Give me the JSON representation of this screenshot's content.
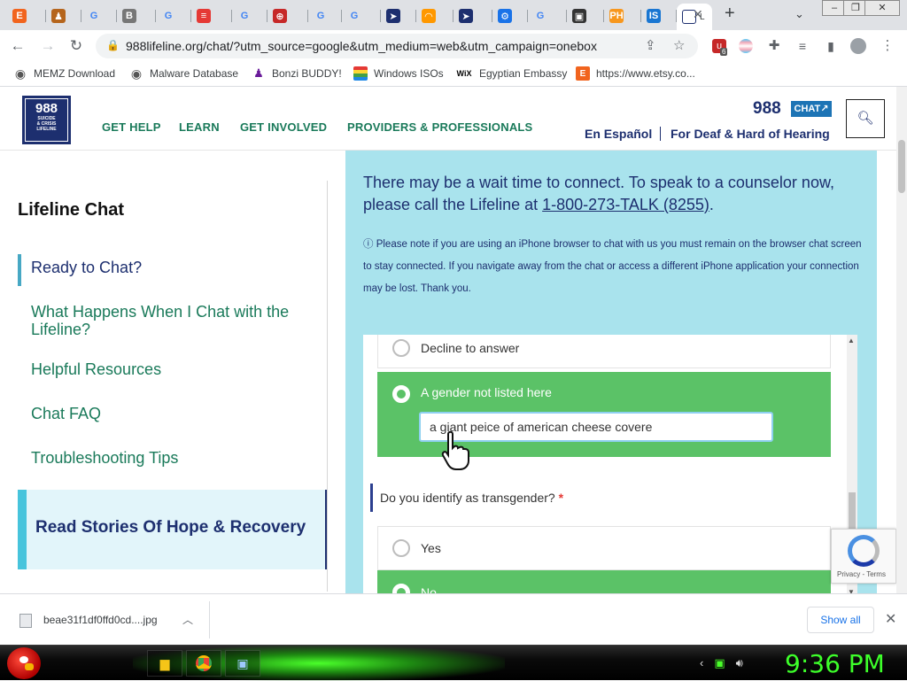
{
  "browser": {
    "tabs": [
      {
        "icon": "etsy-icon",
        "glyph": "E",
        "color": "#f1641e",
        "title": ""
      },
      {
        "icon": "person-icon",
        "glyph": "♟",
        "color": "#b5651d",
        "title": ""
      },
      {
        "icon": "google-icon",
        "glyph": "G",
        "color": "#4285f4",
        "title": ""
      },
      {
        "icon": "speaker-icon",
        "glyph": "B",
        "color": "#777777",
        "title": ""
      },
      {
        "icon": "google-icon",
        "glyph": "G",
        "color": "#4285f4",
        "title": ""
      },
      {
        "icon": "rainbow-flag-icon",
        "glyph": "≡",
        "color": "#e53935",
        "title": ""
      },
      {
        "icon": "google-icon",
        "glyph": "G",
        "color": "#4285f4",
        "title": ""
      },
      {
        "icon": "globe-red-icon",
        "glyph": "⊕",
        "color": "#c62828",
        "title": ""
      },
      {
        "icon": "google-icon",
        "glyph": "G",
        "color": "#4285f4",
        "title": ""
      },
      {
        "icon": "google-icon",
        "glyph": "G",
        "color": "#4285f4",
        "title": ""
      },
      {
        "icon": "cursor-icon",
        "glyph": "➤",
        "color": "#1d2f6f",
        "title": ""
      },
      {
        "icon": "rainbow-icon",
        "glyph": "◠",
        "color": "#ff9800",
        "title": ""
      },
      {
        "icon": "cursor-icon",
        "glyph": "➤",
        "color": "#1d2f6f",
        "title": ""
      },
      {
        "icon": "gear-icon",
        "glyph": "⚙",
        "color": "#1a73e8",
        "title": ""
      },
      {
        "icon": "google-icon",
        "glyph": "G",
        "color": "#4285f4",
        "title": ""
      },
      {
        "icon": "bus-icon",
        "glyph": "▣",
        "color": "#333333",
        "title": ""
      },
      {
        "icon": "ph-icon",
        "glyph": "PH",
        "color": "#f7971e",
        "title": ""
      },
      {
        "icon": "ist-icon",
        "glyph": "IS",
        "color": "#1976d2",
        "title": ""
      },
      {
        "icon": "lifeline-icon",
        "glyph": "",
        "color": "#ffffff",
        "title": "L"
      }
    ],
    "url": "988lifeline.org/chat/?utm_source=google&utm_medium=web&utm_campaign=onebox",
    "bookmarks": [
      {
        "icon": "memz-globe-icon",
        "label": "MEMZ Download"
      },
      {
        "icon": "globe-icon",
        "label": "Malware Database"
      },
      {
        "icon": "bonzi-icon",
        "label": "Bonzi BUDDY!"
      },
      {
        "icon": "windows-icon",
        "label": "Windows ISOs"
      },
      {
        "icon": "wix-icon",
        "label": "Egyptian Embassy"
      },
      {
        "icon": "etsy-icon",
        "label": "https://www.etsy.co..."
      }
    ],
    "extension_badge": "6"
  },
  "site": {
    "logo": {
      "number": "988",
      "line1": "SUICIDE",
      "line2": "& CRISIS",
      "line3": "LIFELINE"
    },
    "nav": [
      "GET HELP",
      "LEARN",
      "GET INVOLVED",
      "PROVIDERS & PROFESSIONALS"
    ],
    "header_number": "988",
    "chat_badge": "CHAT",
    "espanol": "En Español",
    "deaf": "For Deaf & Hard of Hearing"
  },
  "sidebar": {
    "title": "Lifeline Chat",
    "items": [
      "Ready to Chat?",
      "What Happens When I Chat with the Lifeline?",
      "Helpful Resources",
      "Chat FAQ",
      "Troubleshooting Tips"
    ],
    "stories": "Read Stories Of Hope & Recovery"
  },
  "main": {
    "wait_text_before": "There may be a wait time to connect. To speak to a counselor now, please call the Lifeline at ",
    "wait_phone": "1-800-273-TALK (8255)",
    "wait_text_after": ".",
    "iphone_note": "Please note if you are using an iPhone browser to chat with us you must remain on the browser chat screen to stay connected. If you navigate away from the chat or access a different iPhone application your connection may be lost. Thank you.",
    "gender_options": [
      {
        "label": "Decline to answer",
        "selected": false
      },
      {
        "label": "A gender not listed here",
        "selected": true
      }
    ],
    "gender_other_value": "a giant peice of american cheese covere",
    "q_transgender": "Do you identify as transgender?",
    "q_required": "*",
    "trans_options": [
      {
        "label": "Yes",
        "selected": false
      },
      {
        "label": "No",
        "selected": true
      }
    ]
  },
  "recaptcha": {
    "text": "Privacy - Terms"
  },
  "downloads": {
    "file": "beae31f1df0ffd0cd....jpg",
    "show_all": "Show all"
  },
  "taskbar": {
    "clock": "9:36 PM"
  },
  "colors": {
    "brand_navy": "#1d2f6f",
    "nav_green": "#1a7a5a",
    "panel_blue": "#a9e3ed",
    "selected_green": "#5bc267",
    "clock_green": "#3dff2a"
  }
}
